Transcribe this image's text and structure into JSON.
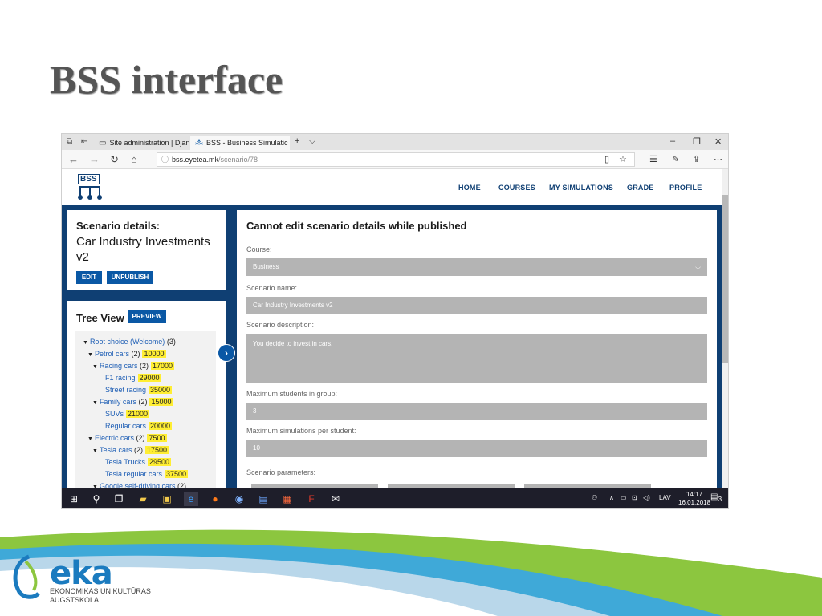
{
  "slide": {
    "title": "BSS interface"
  },
  "browser": {
    "tabs": [
      {
        "label": "Site administration | Django"
      },
      {
        "label": "BSS - Business Simulatic"
      }
    ],
    "tab_close": "✕",
    "new_tab": "+",
    "tab_list": "⌵",
    "window": {
      "minimize": "–",
      "restore": "❐",
      "close": "✕"
    },
    "url": {
      "host": "bss.eyetea.mk",
      "path": "/scenario/78"
    }
  },
  "site": {
    "logo_text": "BSS",
    "nav": [
      "HOME",
      "COURSES",
      "MY SIMULATIONS",
      "GRADE",
      "PROFILE"
    ],
    "colors": {
      "brand": "#0f3f73",
      "button": "#0a58a5",
      "highlight": "#ffee33"
    }
  },
  "scenario_card": {
    "title": "Scenario details:",
    "name": "Car Industry Investments v2",
    "edit_label": "EDIT",
    "unpublish_label": "UNPUBLISH"
  },
  "tree_view": {
    "title": "Tree View",
    "preview_label": "PREVIEW",
    "expander": "›",
    "nodes": [
      {
        "label": "Root choice (Welcome)",
        "count": "(3)",
        "value": ""
      },
      {
        "label": "Petrol cars",
        "count": "(2)",
        "value": "10000"
      },
      {
        "label": "Racing cars",
        "count": "(2)",
        "value": "17000"
      },
      {
        "label": "F1 racing",
        "count": "",
        "value": "29000"
      },
      {
        "label": "Street racing",
        "count": "",
        "value": "35000"
      },
      {
        "label": "Family cars",
        "count": "(2)",
        "value": "15000"
      },
      {
        "label": "SUVs",
        "count": "",
        "value": "21000"
      },
      {
        "label": "Regular cars",
        "count": "",
        "value": "20000"
      },
      {
        "label": "Electric cars",
        "count": "(2)",
        "value": "7500"
      },
      {
        "label": "Tesla cars",
        "count": "(2)",
        "value": "17500"
      },
      {
        "label": "Tesla Trucks",
        "count": "",
        "value": "29500"
      },
      {
        "label": "Tesla regular cars",
        "count": "",
        "value": "37500"
      },
      {
        "label": "Google self-driving cars",
        "count": "(2)",
        "value": ""
      }
    ]
  },
  "form": {
    "heading": "Cannot edit scenario details while published",
    "course_label": "Course:",
    "course_value": "Business",
    "name_label": "Scenario name:",
    "name_value": "Car Industry Investments v2",
    "description_label": "Scenario description:",
    "description_value": "You decide to invest in cars.",
    "max_group_label": "Maximum students in group:",
    "max_group_value": "3",
    "max_sim_label": "Maximum simulations per student:",
    "max_sim_value": "10",
    "params_label": "Scenario parameters:"
  },
  "taskbar": {
    "lang": "LAV",
    "time": "14:17",
    "date": "16.01.2018",
    "notifications": "3"
  },
  "footer": {
    "logo_word": "eka",
    "institution_line1": "EKONOMIKAS UN KULTŪRAS",
    "institution_line2": "AUGSTSKOLA"
  }
}
